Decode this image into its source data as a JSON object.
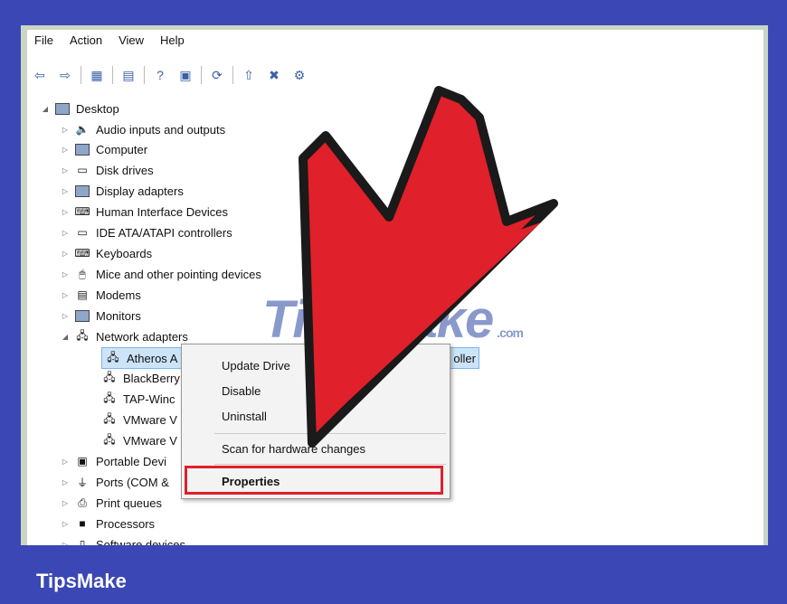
{
  "menubar": [
    "File",
    "Action",
    "View",
    "Help"
  ],
  "toolbar_icons": [
    "back-arrow-icon",
    "forward-arrow-icon",
    "console-icon",
    "properties-icon",
    "help-icon",
    "device-icon",
    "scan-icon",
    "update-driver-icon",
    "uninstall-icon",
    "enable-icon"
  ],
  "tree": {
    "root": "Desktop",
    "items": [
      {
        "label": "Audio inputs and outputs",
        "expanded": false
      },
      {
        "label": "Computer",
        "expanded": false
      },
      {
        "label": "Disk drives",
        "expanded": false
      },
      {
        "label": "Display adapters",
        "expanded": false
      },
      {
        "label": "Human Interface Devices",
        "expanded": false
      },
      {
        "label": "IDE ATA/ATAPI controllers",
        "expanded": false
      },
      {
        "label": "Keyboards",
        "expanded": false
      },
      {
        "label": "Mice and other pointing devices",
        "expanded": false
      },
      {
        "label": "Modems",
        "expanded": false
      },
      {
        "label": "Monitors",
        "expanded": false
      },
      {
        "label": "Network adapters",
        "expanded": true
      }
    ],
    "network_children": [
      "Atheros A",
      "BlackBerry",
      "TAP-Winc",
      "VMware V",
      "VMware V"
    ],
    "selected_tail": "oller",
    "after_items": [
      "Portable Devi",
      "Ports (COM &",
      "Print queues",
      "Processors",
      "Software devices"
    ]
  },
  "context_menu": {
    "items": [
      "Update Drive",
      "Disable",
      "Uninstall",
      "Scan for hardware changes",
      "Properties"
    ]
  },
  "watermark": {
    "main": "TipsMake",
    "suffix": ".com"
  },
  "footer": {
    "brand": "TipsMake"
  },
  "colors": {
    "frame": "#3b47b5",
    "highlight": "#e0202a",
    "arrow": "#e0202a"
  }
}
